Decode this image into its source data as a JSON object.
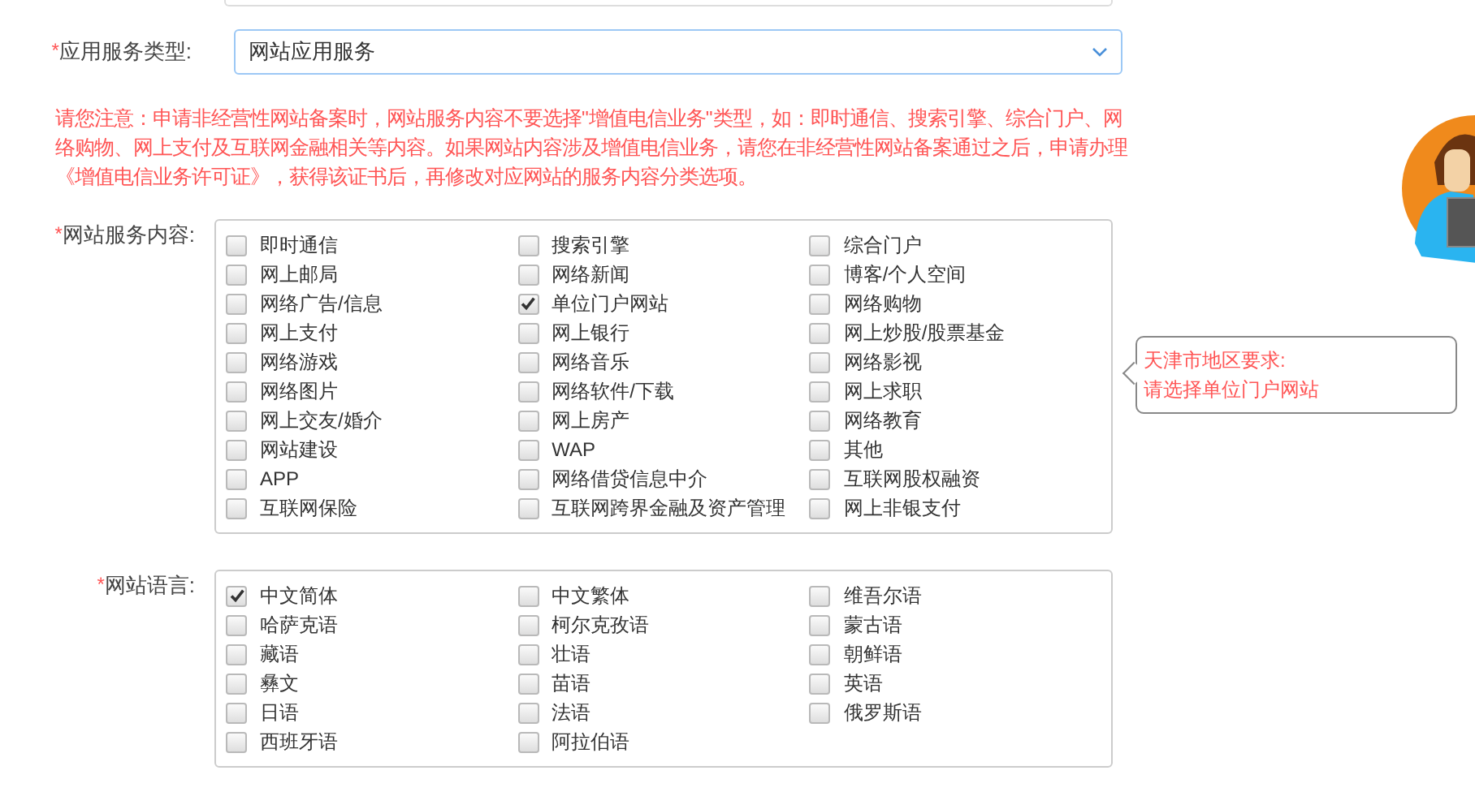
{
  "service_type": {
    "required_mark": "*",
    "label": "应用服务类型:",
    "value": "网站应用服务"
  },
  "notice": "请您注意：申请非经营性网站备案时，网站服务内容不要选择\"增值电信业务\"类型，如：即时通信、搜索引擎、综合门户、网络购物、网上支付及互联网金融相关等内容。如果网站内容涉及增值电信业务，请您在非经营性网站备案通过之后，申请办理《增值电信业务许可证》，获得该证书后，再修改对应网站的服务内容分类选项。",
  "service_content": {
    "required_mark": "*",
    "label": "网站服务内容:",
    "options": [
      {
        "label": "即时通信",
        "checked": false
      },
      {
        "label": "搜索引擎",
        "checked": false
      },
      {
        "label": "综合门户",
        "checked": false
      },
      {
        "label": "网上邮局",
        "checked": false
      },
      {
        "label": "网络新闻",
        "checked": false
      },
      {
        "label": "博客/个人空间",
        "checked": false
      },
      {
        "label": "网络广告/信息",
        "checked": false
      },
      {
        "label": "单位门户网站",
        "checked": true
      },
      {
        "label": "网络购物",
        "checked": false
      },
      {
        "label": "网上支付",
        "checked": false
      },
      {
        "label": "网上银行",
        "checked": false
      },
      {
        "label": "网上炒股/股票基金",
        "checked": false
      },
      {
        "label": "网络游戏",
        "checked": false
      },
      {
        "label": "网络音乐",
        "checked": false
      },
      {
        "label": "网络影视",
        "checked": false
      },
      {
        "label": "网络图片",
        "checked": false
      },
      {
        "label": "网络软件/下载",
        "checked": false
      },
      {
        "label": "网上求职",
        "checked": false
      },
      {
        "label": "网上交友/婚介",
        "checked": false
      },
      {
        "label": "网上房产",
        "checked": false
      },
      {
        "label": "网络教育",
        "checked": false
      },
      {
        "label": "网站建设",
        "checked": false
      },
      {
        "label": "WAP",
        "checked": false
      },
      {
        "label": "其他",
        "checked": false
      },
      {
        "label": "APP",
        "checked": false
      },
      {
        "label": "网络借贷信息中介",
        "checked": false
      },
      {
        "label": "互联网股权融资",
        "checked": false
      },
      {
        "label": "互联网保险",
        "checked": false
      },
      {
        "label": "互联网跨界金融及资产管理",
        "checked": false
      },
      {
        "label": "网上非银支付",
        "checked": false
      }
    ]
  },
  "tooltip": {
    "title": "天津市地区要求:",
    "text": "请选择单位门户网站"
  },
  "languages": {
    "required_mark": "*",
    "label": "网站语言:",
    "options": [
      {
        "label": "中文简体",
        "checked": true
      },
      {
        "label": "中文繁体",
        "checked": false
      },
      {
        "label": "维吾尔语",
        "checked": false
      },
      {
        "label": "哈萨克语",
        "checked": false
      },
      {
        "label": "柯尔克孜语",
        "checked": false
      },
      {
        "label": "蒙古语",
        "checked": false
      },
      {
        "label": "藏语",
        "checked": false
      },
      {
        "label": "壮语",
        "checked": false
      },
      {
        "label": "朝鲜语",
        "checked": false
      },
      {
        "label": "彝文",
        "checked": false
      },
      {
        "label": "苗语",
        "checked": false
      },
      {
        "label": "英语",
        "checked": false
      },
      {
        "label": "日语",
        "checked": false
      },
      {
        "label": "法语",
        "checked": false
      },
      {
        "label": "俄罗斯语",
        "checked": false
      },
      {
        "label": "西班牙语",
        "checked": false
      },
      {
        "label": "阿拉伯语",
        "checked": false
      }
    ]
  }
}
